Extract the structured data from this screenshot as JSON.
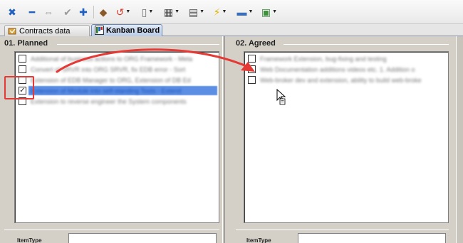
{
  "toolbar": {
    "items": [
      {
        "name": "close-icon",
        "glyph": "✖",
        "color": "#1f5fbf"
      },
      {
        "name": "minus-icon",
        "glyph": "━",
        "color": "#1f5fbf"
      },
      {
        "name": "link-icon",
        "glyph": "⇔",
        "color": "#9a9a9a"
      },
      {
        "name": "check-icon",
        "glyph": "✔",
        "color": "#9a9a9a"
      },
      {
        "name": "plus-icon",
        "glyph": "✚",
        "color": "#1f5fbf"
      },
      {
        "name": "eraser-icon",
        "glyph": "◆",
        "color": "#8a5a2a"
      },
      {
        "name": "undo-icon",
        "glyph": "↺",
        "color": "#d23b2b"
      },
      {
        "name": "document-icon",
        "glyph": "▯",
        "color": "#6f6f6f"
      },
      {
        "name": "grid-icon",
        "glyph": "▦",
        "color": "#4d4d4d"
      },
      {
        "name": "form-icon",
        "glyph": "▤",
        "color": "#4d4d4d"
      },
      {
        "name": "lightning-icon",
        "glyph": "⚡",
        "color": "#e0b400"
      },
      {
        "name": "printer-icon",
        "glyph": "▬",
        "color": "#3a6fb8"
      },
      {
        "name": "export-icon",
        "glyph": "▣",
        "color": "#3f8f3f"
      }
    ]
  },
  "tabs": [
    {
      "label": "Contracts data",
      "active": false
    },
    {
      "label": "Kanban Board",
      "active": true
    }
  ],
  "lanes": [
    {
      "title": "01. Planned",
      "items": [
        {
          "text": "Additional of business actions to ORG Framework  - Meta",
          "checked": false,
          "selected": false
        },
        {
          "text": "Convert of SRVR into ORG SRVR, fix EDB error - Sort",
          "checked": false,
          "selected": false
        },
        {
          "text": "Extension of EDB Manager to ORG, Extension of DB Ed",
          "checked": false,
          "selected": false
        },
        {
          "text": "Extension of Module into self-standing Tools - Extend",
          "checked": true,
          "selected": true
        },
        {
          "text": "Extension to reverse engineer the System components",
          "checked": false,
          "selected": false
        }
      ],
      "field_label": "ItemType"
    },
    {
      "title": "02. Agreed",
      "items": [
        {
          "text": "Framework Extension, bug-fixing and testing",
          "checked": false,
          "selected": false
        },
        {
          "text": "Web Documentation additions videos etc. 1. Addition o",
          "checked": false,
          "selected": false
        },
        {
          "text": "Web-broker dev and extension, ability to build web-broke",
          "checked": false,
          "selected": false
        }
      ],
      "field_label": "ItemType"
    }
  ],
  "colors": {
    "annotation": "#e53935",
    "selection": "#5c8fe4"
  }
}
